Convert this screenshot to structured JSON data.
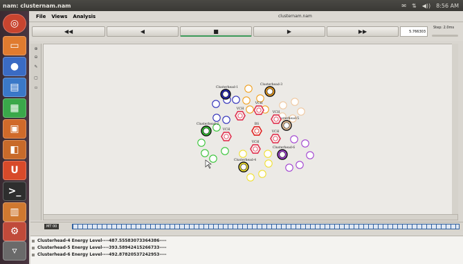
{
  "window_title": "nam: clusternam.nam",
  "top_indicators": [
    "✉",
    "⇅",
    "◀))",
    "8:56 AM"
  ],
  "menu": [
    "File",
    "Views",
    "Analysis"
  ],
  "filename": "clusternam.nam",
  "playback": {
    "rewind": "◀◀",
    "back": "◀",
    "stop": "■",
    "play": "▶",
    "ffwd": "▶▶",
    "time": "5.766303",
    "step": "Step: 2.0ms"
  },
  "timeline_label": "MT 00",
  "log_lines": [
    "Clusterhead-4 Energy Level----487.55583073364386----",
    "Clusterhead-5 Energy Level----393.58942415266733----",
    "Clusterhead-6 Energy Level----492.87820537242953----"
  ],
  "graph": {
    "labels": [
      {
        "text": "Clusterhead-1",
        "group": "blue"
      },
      {
        "text": "Clusterhead-2",
        "group": "green"
      },
      {
        "text": "Clusterhead-3",
        "group": "orange"
      },
      {
        "text": "Clusterhead-4",
        "group": "yellow"
      },
      {
        "text": "Clusterhead-5",
        "group": "peach"
      },
      {
        "text": "Clusterhead-6",
        "group": "purple"
      },
      {
        "text": "VCH",
        "group": "blue"
      },
      {
        "text": "VCH",
        "group": "green"
      },
      {
        "text": "VCH",
        "group": "orange"
      },
      {
        "text": "VCH",
        "group": "yellow"
      },
      {
        "text": "VCH",
        "group": "peach"
      },
      {
        "text": "VCH",
        "group": "purple"
      },
      {
        "text": "BS",
        "group": "center"
      }
    ],
    "colors": {
      "blue": "#2a2ab8",
      "green": "#35c435",
      "orange": "#f0a020",
      "yellow": "#f0e030",
      "peach": "#f0c8a0",
      "purple": "#a040d0",
      "center": "#e02020",
      "vch": "#e03050"
    }
  }
}
